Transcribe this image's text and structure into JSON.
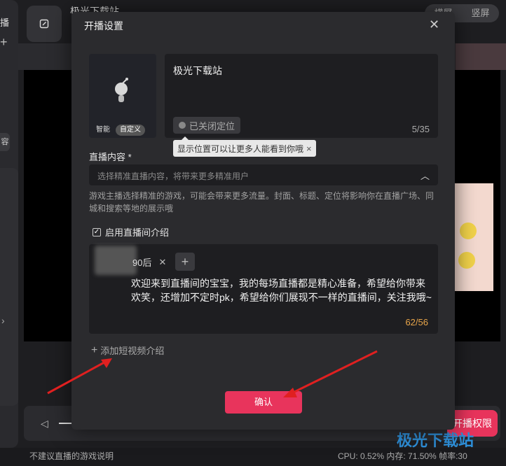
{
  "background": {
    "left_label": "播",
    "left_chip": "容",
    "page_title": "极光下载站",
    "orientation_tabs": [
      "横屏",
      "竖屏"
    ],
    "live_button": "开播权限",
    "status_left": "不建议直播的游戏说明",
    "status_right": "CPU: 0.52%  内存: 71.50%  帧率:30",
    "watermark": "极光下载站"
  },
  "dialog": {
    "title": "开播设置",
    "cover_tabs": [
      "智能",
      "自定义"
    ],
    "cover_active_tab": "自定义",
    "stream_title": "极光下载站",
    "location_chip": "已关闭定位",
    "title_count": "5/35",
    "tooltip": "显示位置可以让更多人能看到你哦",
    "content_label": "直播内容 *",
    "content_placeholder": "选择精准直播内容，将带来更多精准用户",
    "hint": "游戏主播选择精准的游戏，可能会带来更多流量。封面、标题、定位将影响你在直播广场、同城和搜索等地的展示哦",
    "intro_toggle_label": "启用直播间介绍",
    "intro_toggle_checked": true,
    "intro_tag": "90后",
    "intro_text": "欢迎来到直播间的宝宝，我的每场直播都是精心准备，希望给你带来欢笑，还增加不定时pk，希望给你们展现不一样的直播间，关注我哦~",
    "intro_count": "62/56",
    "add_video_label": "添加短视频介绍",
    "confirm_label": "确认"
  },
  "colors": {
    "accent": "#e8345c",
    "count_warning": "#e8a54a"
  }
}
